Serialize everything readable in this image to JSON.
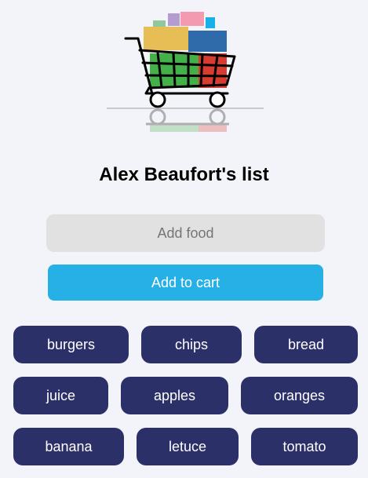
{
  "header": {
    "title": "Alex Beaufort's list",
    "logo_icon": "shopping-cart-icon"
  },
  "form": {
    "placeholder": "Add food",
    "value": "",
    "button_label": "Add to cart"
  },
  "items": [
    {
      "label": "burgers"
    },
    {
      "label": "chips"
    },
    {
      "label": "bread"
    },
    {
      "label": "juice"
    },
    {
      "label": "apples"
    },
    {
      "label": "oranges"
    },
    {
      "label": "banana"
    },
    {
      "label": "letuce"
    },
    {
      "label": "tomato"
    }
  ],
  "colors": {
    "page_background": "#f3f4f9",
    "button_accent": "#27b0e6",
    "item_background": "#2b3068",
    "input_background": "#e1e1e1"
  }
}
